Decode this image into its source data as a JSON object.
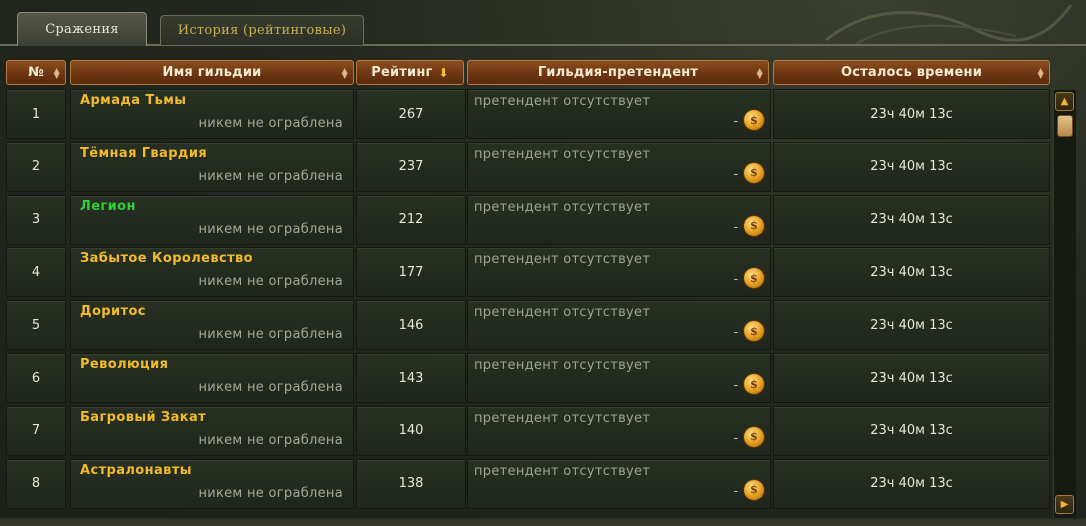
{
  "tabs": [
    {
      "label": "Сражения",
      "active": true
    },
    {
      "label": "История (рейтинговые)",
      "active": false
    }
  ],
  "headers": {
    "num": "№",
    "guild": "Имя гильдии",
    "rating": "Рейтинг",
    "pretender": "Гильдия-претендент",
    "time": "Осталось времени"
  },
  "colors": {
    "header_bg": "#6b3410",
    "guild_name": "#f1bb2a",
    "guild_name_highlight": "#2fd13a",
    "row_bg": "#252d21"
  },
  "rows": [
    {
      "num": "1",
      "guild": "Армада Тьмы",
      "status": "никем не ограблена",
      "rating": "267",
      "pretender": "претендент отсутствует",
      "dash": "-",
      "time": "23ч 40м 13с",
      "highlight": false
    },
    {
      "num": "2",
      "guild": "Тёмная Гвардия",
      "status": "никем не ограблена",
      "rating": "237",
      "pretender": "претендент отсутствует",
      "dash": "-",
      "time": "23ч 40м 13с",
      "highlight": false
    },
    {
      "num": "3",
      "guild": "Легион",
      "status": "никем не ограблена",
      "rating": "212",
      "pretender": "претендент отсутствует",
      "dash": "-",
      "time": "23ч 40м 13с",
      "highlight": true
    },
    {
      "num": "4",
      "guild": "Забытое Королевство",
      "status": "никем не ограблена",
      "rating": "177",
      "pretender": "претендент отсутствует",
      "dash": "-",
      "time": "23ч 40м 13с",
      "highlight": false
    },
    {
      "num": "5",
      "guild": "Доритос",
      "status": "никем не ограблена",
      "rating": "146",
      "pretender": "претендент отсутствует",
      "dash": "-",
      "time": "23ч 40м 13с",
      "highlight": false
    },
    {
      "num": "6",
      "guild": "Революция",
      "status": "никем не ограблена",
      "rating": "143",
      "pretender": "претендент отсутствует",
      "dash": "-",
      "time": "23ч 40м 13с",
      "highlight": false
    },
    {
      "num": "7",
      "guild": "Багровый Закат",
      "status": "никем не ограблена",
      "rating": "140",
      "pretender": "претендент отсутствует",
      "dash": "-",
      "time": "23ч 40м 13с",
      "highlight": false
    },
    {
      "num": "8",
      "guild": "Астралонавты",
      "status": "никем не ограблена",
      "rating": "138",
      "pretender": "претендент отсутствует",
      "dash": "-",
      "time": "23ч 40м 13с",
      "highlight": false
    }
  ],
  "icons": {
    "coin": "gold-coin-icon",
    "sort": "sort-arrows-icon",
    "sort_active": "sort-desc-icon",
    "scroll_up": "scroll-up-icon",
    "scroll_down": "scroll-down-icon"
  }
}
